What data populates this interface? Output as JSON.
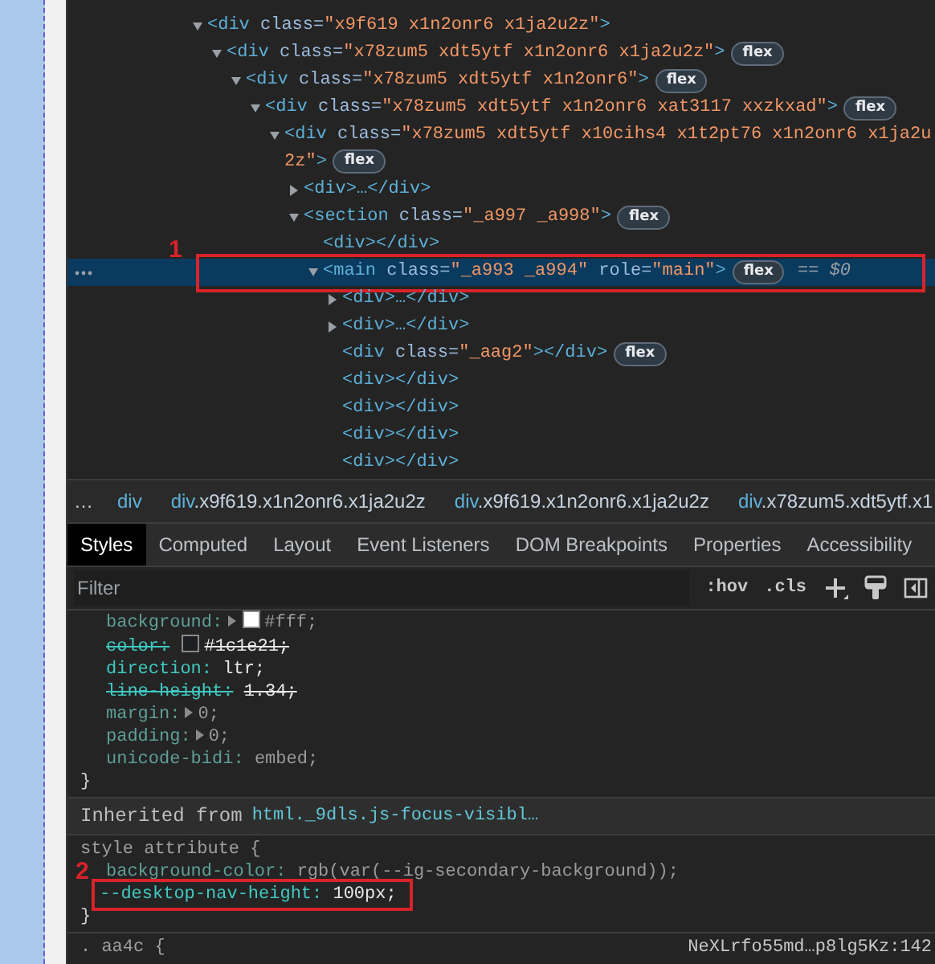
{
  "elements_tree": [
    {
      "markup": "<div class=\"x9f619 x1n2onr6 x1ja2u2z\">",
      "kind": "parent",
      "expanded": true,
      "selected": false,
      "children": [
        {
          "markup": "<div class=\"x78zum5 xdt5ytf x1n2onr6 x1ja2u2z\">",
          "badge": "flex",
          "kind": "parent",
          "expanded": true,
          "selected": false,
          "children": [
            {
              "markup": "<div class=\"x78zum5 xdt5ytf x1n2onr6\">",
              "badge": "flex",
              "kind": "parent",
              "expanded": true,
              "selected": false,
              "children": [
                {
                  "markup": "<div class=\"x78zum5 xdt5ytf x1n2onr6 xat3117 xxzkxad\">",
                  "badge": "flex",
                  "kind": "parent",
                  "expanded": true,
                  "selected": false,
                  "children": [
                    {
                      "markup": "<div class=\"x78zum5 xdt5ytf x10cihs4 x1t2pt76 x1n2onr6 x1ja2u2z\">",
                      "badge": "flex",
                      "kind": "parent",
                      "expanded": true,
                      "selected": false,
                      "children": [
                        {
                          "markup": "<div>",
                          "tail": "…</div>",
                          "kind": "parent",
                          "expanded": false,
                          "selected": false
                        },
                        {
                          "markup": "<section class=\"_a997 _a998\">",
                          "badge": "flex",
                          "kind": "parent",
                          "expanded": true,
                          "selected": false,
                          "children": [
                            {
                              "markup": "<div>",
                              "tail": "</div>",
                              "kind": "leaf",
                              "selected": false
                            },
                            {
                              "markup": "<main class=\"_a993 _a994\" role=\"main\">",
                              "badge": "flex",
                              "console_ref": "== $0",
                              "marker": "1",
                              "kind": "parent",
                              "expanded": true,
                              "selected": true,
                              "children": [
                                {
                                  "markup": "<div>",
                                  "tail": "…</div>",
                                  "kind": "parent",
                                  "expanded": false,
                                  "selected": false
                                },
                                {
                                  "markup": "<div>",
                                  "tail": "…</div>",
                                  "kind": "parent",
                                  "expanded": false,
                                  "selected": false
                                },
                                {
                                  "markup": "<div class=\"_aag2\">",
                                  "tail": "</div>",
                                  "badge": "flex",
                                  "kind": "leaf",
                                  "selected": false
                                },
                                {
                                  "markup": "<div>",
                                  "tail": "</div>",
                                  "kind": "leaf",
                                  "selected": false
                                },
                                {
                                  "markup": "<div>",
                                  "tail": "</div>",
                                  "kind": "leaf",
                                  "selected": false
                                },
                                {
                                  "markup": "<div>",
                                  "tail": "</div>",
                                  "kind": "leaf",
                                  "selected": false
                                },
                                {
                                  "markup": "<div>",
                                  "tail": "</div>",
                                  "kind": "leaf",
                                  "selected": false
                                }
                              ]
                            }
                          ]
                        }
                      ]
                    }
                  ]
                }
              ]
            }
          ]
        }
      ]
    }
  ],
  "breadcrumbs": {
    "overflow": "…",
    "items": [
      {
        "tag": "div"
      },
      {
        "tag": "div",
        "classes": ".x9f619.x1n2onr6.x1ja2u2z"
      },
      {
        "tag": "div",
        "classes": ".x9f619.x1n2onr6.x1ja2u2z"
      },
      {
        "tag": "div",
        "classes": ".x78zum5.xdt5ytf.x1"
      }
    ]
  },
  "tabs": [
    {
      "label": "Styles",
      "selected": true
    },
    {
      "label": "Computed",
      "selected": false
    },
    {
      "label": "Layout",
      "selected": false
    },
    {
      "label": "Event Listeners",
      "selected": false
    },
    {
      "label": "DOM Breakpoints",
      "selected": false
    },
    {
      "label": "Properties",
      "selected": false
    },
    {
      "label": "Accessibility",
      "selected": false
    }
  ],
  "filter": {
    "placeholder": "Filter",
    "buttons": [
      ":hov",
      ".cls"
    ]
  },
  "styles_pane": [
    {
      "kind": "rule",
      "closing": "}",
      "declarations": [
        {
          "property": "background:",
          "value": "#fff;",
          "color": "#ffffff",
          "expandable": true,
          "inactive": true,
          "overridden": false
        },
        {
          "property": "color:",
          "value": "#1c1e21;",
          "color": "#1c1e21",
          "expandable": false,
          "inactive": false,
          "overridden": true
        },
        {
          "property": "direction:",
          "value": "ltr;",
          "expandable": false,
          "inactive": false,
          "overridden": false
        },
        {
          "property": "line-height:",
          "value": "1.34;",
          "expandable": false,
          "inactive": false,
          "overridden": true
        },
        {
          "property": "margin:",
          "value": "0;",
          "expandable": true,
          "inactive": true,
          "overridden": false
        },
        {
          "property": "padding:",
          "value": "0;",
          "expandable": true,
          "inactive": true,
          "overridden": false
        },
        {
          "property": "unicode-bidi:",
          "value": "embed;",
          "expandable": false,
          "inactive": true,
          "overridden": false
        }
      ]
    },
    {
      "kind": "inherited",
      "label": "Inherited from",
      "element": "html._9dls.js-focus-visibl…"
    },
    {
      "kind": "rule",
      "selector": "style attribute {",
      "closing": "}",
      "declarations": [
        {
          "property": "background-color:",
          "value": "rgb(var(--ig-secondary-background));",
          "expandable": false,
          "inactive": true,
          "overridden": false
        },
        {
          "property": "--desktop-nav-height:",
          "value": "100px;",
          "expandable": false,
          "inactive": false,
          "overridden": false,
          "marker": "2"
        }
      ]
    },
    {
      "kind": "rule",
      "selector": ". aa4c {",
      "source": "NeXLrfo55md…p8lg5Kz:142"
    }
  ]
}
